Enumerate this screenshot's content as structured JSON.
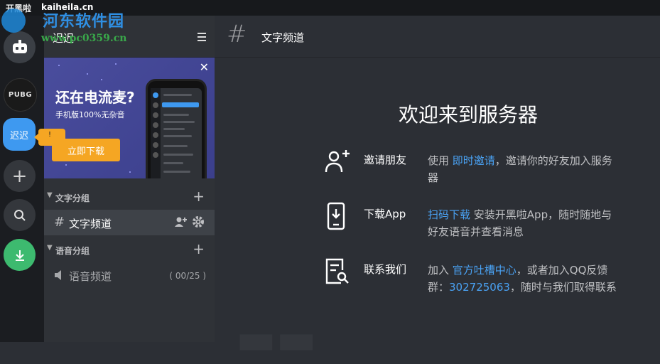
{
  "titlebar": {
    "app_name": "开黑啦",
    "domain": "kaiheila.cn"
  },
  "watermark": {
    "title": "河东软件园",
    "url": "www.pc0359.cn"
  },
  "servers": {
    "pubg_label": "PUBG",
    "active_label": "迟迟",
    "add_symbol": "+",
    "tooltip_text": "!"
  },
  "channels": {
    "server_title": "迟迟",
    "banner": {
      "title": "还在电流麦?",
      "subtitle": "手机版100%无杂音",
      "button": "立即下载"
    },
    "text_category": "文字分组",
    "text_channel": "文字频道",
    "voice_category": "语音分组",
    "voice_channel": "语音频道",
    "voice_count": "( 00/25 )"
  },
  "main": {
    "channel_title": "文字频道",
    "welcome": "欢迎来到服务器",
    "invite": {
      "title": "邀请朋友",
      "pre": "使用 ",
      "link": "即时邀请",
      "post": "，邀请你的好友加入服务器"
    },
    "download": {
      "title": "下载App",
      "link": "扫码下载",
      "post": " 安装开黑啦App，随时随地与好友语音并查看消息"
    },
    "contact": {
      "title": "联系我们",
      "pre": "加入 ",
      "link": "官方吐槽中心",
      "mid": "，或者加入QQ反馈群：",
      "qq": "302725063",
      "post": "，随时与我们取得联系"
    }
  },
  "colors": {
    "accent": "#3e99f0",
    "download_green": "#3dba6f",
    "banner_button": "#f5a623"
  }
}
